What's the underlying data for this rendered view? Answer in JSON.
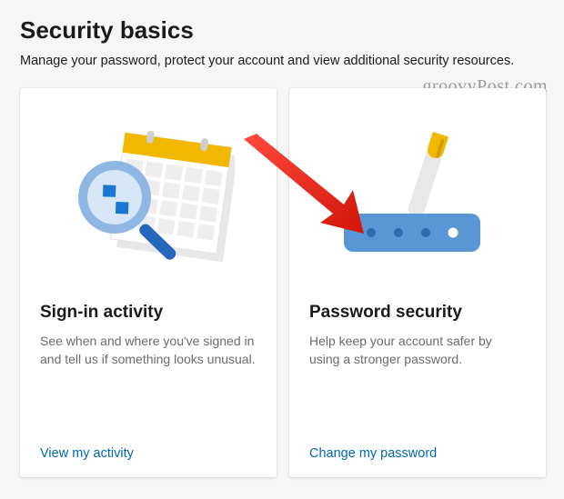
{
  "header": {
    "title": "Security basics",
    "subtitle": "Manage your password, protect your account and view additional security resources."
  },
  "watermark": "groovyPost.com",
  "cards": [
    {
      "title": "Sign-in activity",
      "description": "See when and where you've signed in and tell us if something looks unusual.",
      "link_label": "View my activity"
    },
    {
      "title": "Password security",
      "description": "Help keep your account safer by using a stronger password.",
      "link_label": "Change my password"
    }
  ]
}
